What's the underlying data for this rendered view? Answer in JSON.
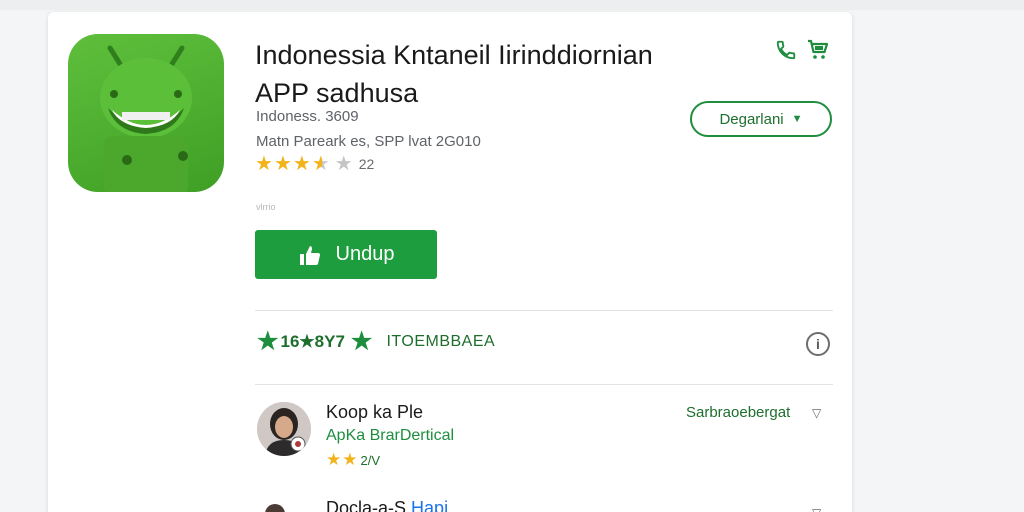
{
  "app": {
    "title_line1": "Indonessia Kntaneil Iirinddiornian",
    "title_line2": "APP sadhusa",
    "meta_line1": "Indoness. 3609",
    "meta_line2": "Matn Pareark es, SPP  lvat 2G010",
    "rating_count": "22",
    "tiny_text": "vlrrio",
    "icon_name": "android-robot-icon"
  },
  "header_actions": {
    "phone_icon": "phone-icon",
    "cart_icon": "shopping-cart-icon"
  },
  "dropdown": {
    "label": "Degarlani"
  },
  "install": {
    "label": "Undup"
  },
  "stats": {
    "value": "16★8Y7",
    "label": "ITOEMBBAEA"
  },
  "reviews": [
    {
      "name": "Koop ka Ple",
      "subtitle": "ApKa BrarDertical",
      "stars_value": "2/V",
      "action": "Sarbraoebergat"
    },
    {
      "name": "Docla-a-S",
      "link": "Hapi"
    }
  ],
  "colors": {
    "accent_green": "#1e9d3f",
    "text_green": "#1e6e2e",
    "star_gold": "#f2b41c",
    "app_icon_green": "#4caf31"
  }
}
